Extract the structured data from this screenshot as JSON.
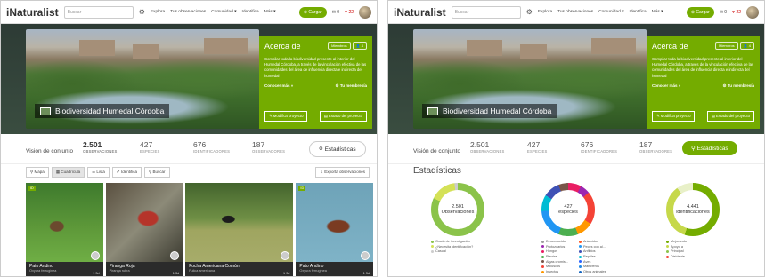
{
  "header": {
    "logo": "iNaturalist",
    "search_placeholder": "Buscar",
    "nav": [
      "Explora",
      "Tus observaciones",
      "Comunidad ▾",
      "Identifica",
      "Más ▾"
    ],
    "upload_label": "Cargar",
    "messages_count": "0",
    "notifications_count": "22"
  },
  "project": {
    "title": "Biodiversidad Humedal Córdoba",
    "about_title": "Acerca de",
    "members_label": "Miembros",
    "members_count": "4",
    "description": "Compilar toda la biodiversidad presente al interior del Humedal Córdoba, a través de la vinculación efectiva de las comunidades del área de influencia directa e indirecta del humedal",
    "learn_more": "Conocer más »",
    "membership": "Tu membresía",
    "modify_button": "Modifica proyecto",
    "status_button": "Estado del proyecto"
  },
  "stats": {
    "overview_label": "Visión de conjunto",
    "items": [
      {
        "value": "2.501",
        "label": "OBSERVACIONES"
      },
      {
        "value": "427",
        "label": "ESPECIES"
      },
      {
        "value": "676",
        "label": "IDENTIFICADORES"
      },
      {
        "value": "187",
        "label": "OBSERVADORES"
      }
    ],
    "button_label": "Estadísticas"
  },
  "viewbar": {
    "buttons": [
      "Mapa",
      "Cuadrícula",
      "Lista",
      "Identifica",
      "Buscar"
    ],
    "export_label": "Exporta observaciones"
  },
  "observations": [
    {
      "name": "Pato Andino",
      "scientific": "Oxyura ferruginea",
      "time": "1 3d",
      "badge": "ID"
    },
    {
      "name": "Piranga Roja",
      "scientific": "Piranga rubra",
      "time": "1 3d",
      "badge": ""
    },
    {
      "name": "Focha Americana Común",
      "scientific": "Fulica americana",
      "time": "1 3d",
      "badge": ""
    },
    {
      "name": "Pato Andino",
      "scientific": "Oxyura ferruginea",
      "time": "1 3d",
      "badge": "ID"
    }
  ],
  "statistics": {
    "title": "Estadísticas",
    "donuts": [
      {
        "number": "2.501",
        "label": "Observaciones",
        "colors": [
          "#8bc34a",
          "#d4e157",
          "#cccccc"
        ],
        "fractions": [
          0.82,
          0.16,
          0.02
        ],
        "legend": [
          {
            "label": "Grado de investigación",
            "color": "#8bc34a"
          },
          {
            "label": "¿Necesita identificación?",
            "color": "#d4e157"
          },
          {
            "label": "Casual",
            "color": "#cccccc"
          }
        ]
      },
      {
        "number": "427",
        "label": "especies",
        "colors": [
          "#e91e63",
          "#9c27b0",
          "#f44336",
          "#ff9800",
          "#4caf50",
          "#2196f3",
          "#00bcd4",
          "#3f51b5",
          "#795548"
        ],
        "fractions": [
          0.08,
          0.06,
          0.2,
          0.1,
          0.12,
          0.18,
          0.1,
          0.1,
          0.06
        ],
        "legend": [
          {
            "label": "Desconocido",
            "color": "#9e9e9e"
          },
          {
            "label": "Arácnidos",
            "color": "#ff5722"
          },
          {
            "label": "Protozoarios",
            "color": "#9c27b0"
          },
          {
            "label": "Peces con al...",
            "color": "#2196f3"
          },
          {
            "label": "Hongos",
            "color": "#e91e63"
          },
          {
            "label": "Anfibios",
            "color": "#3f51b5"
          },
          {
            "label": "Plantas",
            "color": "#4caf50"
          },
          {
            "label": "Reptiles",
            "color": "#00bcd4"
          },
          {
            "label": "Algas cromis...",
            "color": "#795548"
          },
          {
            "label": "Aves",
            "color": "#2962ff"
          },
          {
            "label": "Moluscos",
            "color": "#f44336"
          },
          {
            "label": "Mamíferos",
            "color": "#1e88e5"
          },
          {
            "label": "Insectos",
            "color": "#ff9800"
          },
          {
            "label": "Otros animales",
            "color": "#1565c0"
          }
        ]
      },
      {
        "number": "4.441",
        "label": "identificaciones",
        "colors": [
          "#74ac00",
          "#c6d84a",
          "#e8f0c8"
        ],
        "fractions": [
          0.55,
          0.35,
          0.1
        ],
        "legend": [
          {
            "label": "Mejorando",
            "color": "#74ac00"
          },
          {
            "label": "Apoyo a",
            "color": "#c6d84a"
          },
          {
            "label": "Principal",
            "color": "#8bc34a"
          },
          {
            "label": "Disidente",
            "color": "#f44336"
          }
        ]
      }
    ]
  }
}
